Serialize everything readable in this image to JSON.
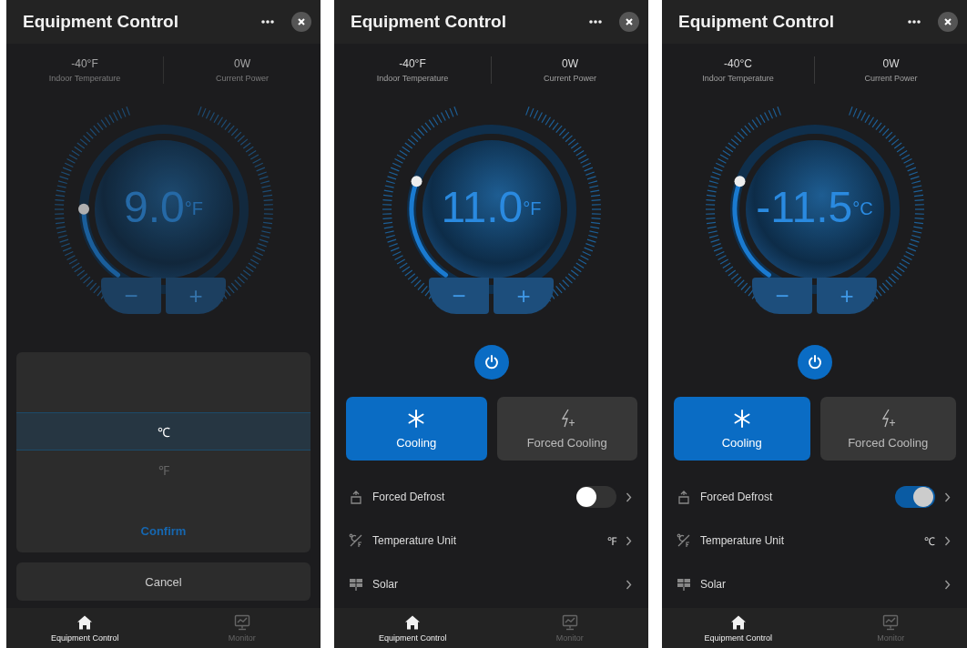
{
  "screens": [
    {
      "header": {
        "title": "Equipment Control"
      },
      "stats": [
        {
          "value": "-40°F",
          "label": "Indoor Temperature"
        },
        {
          "value": "0W",
          "label": "Current Power"
        }
      ],
      "dial": {
        "setpoint": "9.0",
        "unit": "°F",
        "level": 0.19,
        "minus": "−",
        "plus": "+"
      },
      "picker": {
        "options": [
          {
            "label": "℃",
            "selected": true
          },
          {
            "label": "℉",
            "selected": false
          }
        ],
        "confirm": "Confirm",
        "cancel": "Cancel"
      },
      "tab_bar": [
        {
          "label": "Equipment Control",
          "selected": true
        },
        {
          "label": "Monitor",
          "selected": false
        }
      ]
    },
    {
      "header": {
        "title": "Equipment Control"
      },
      "stats": [
        {
          "value": "-40°F",
          "label": "Indoor Temperature"
        },
        {
          "value": "0W",
          "label": "Current Power"
        }
      ],
      "dial": {
        "setpoint": "11.0",
        "unit": "°F",
        "level": 0.26,
        "minus": "−",
        "plus": "+"
      },
      "power": {
        "on": true
      },
      "modes": [
        {
          "kind": "cooling",
          "label": "Cooling",
          "selected": true
        },
        {
          "kind": "forced",
          "label": "Forced Cooling",
          "selected": false
        }
      ],
      "settings": [
        {
          "kind": "toggle",
          "label": "Forced Defrost",
          "on": false
        },
        {
          "kind": "value",
          "label": "Temperature Unit",
          "value": "℉"
        },
        {
          "kind": "link",
          "label": "Solar"
        }
      ],
      "tab_bar": [
        {
          "label": "Equipment Control",
          "selected": true
        },
        {
          "label": "Monitor",
          "selected": false
        }
      ]
    },
    {
      "header": {
        "title": "Equipment Control"
      },
      "stats": [
        {
          "value": "-40°C",
          "label": "Indoor Temperature"
        },
        {
          "value": "0W",
          "label": "Current Power"
        }
      ],
      "dial": {
        "setpoint": "-11.5",
        "unit": "°C",
        "level": 0.26,
        "minus": "−",
        "plus": "+"
      },
      "power": {
        "on": true
      },
      "modes": [
        {
          "kind": "cooling",
          "label": "Cooling",
          "selected": true
        },
        {
          "kind": "forced",
          "label": "Forced Cooling",
          "selected": false
        }
      ],
      "settings": [
        {
          "kind": "toggle",
          "label": "Forced Defrost",
          "on": true
        },
        {
          "kind": "value",
          "label": "Temperature Unit",
          "value": "℃"
        },
        {
          "kind": "link",
          "label": "Solar"
        }
      ],
      "tab_bar": [
        {
          "label": "Equipment Control",
          "selected": true
        },
        {
          "label": "Monitor",
          "selected": false
        }
      ]
    }
  ]
}
